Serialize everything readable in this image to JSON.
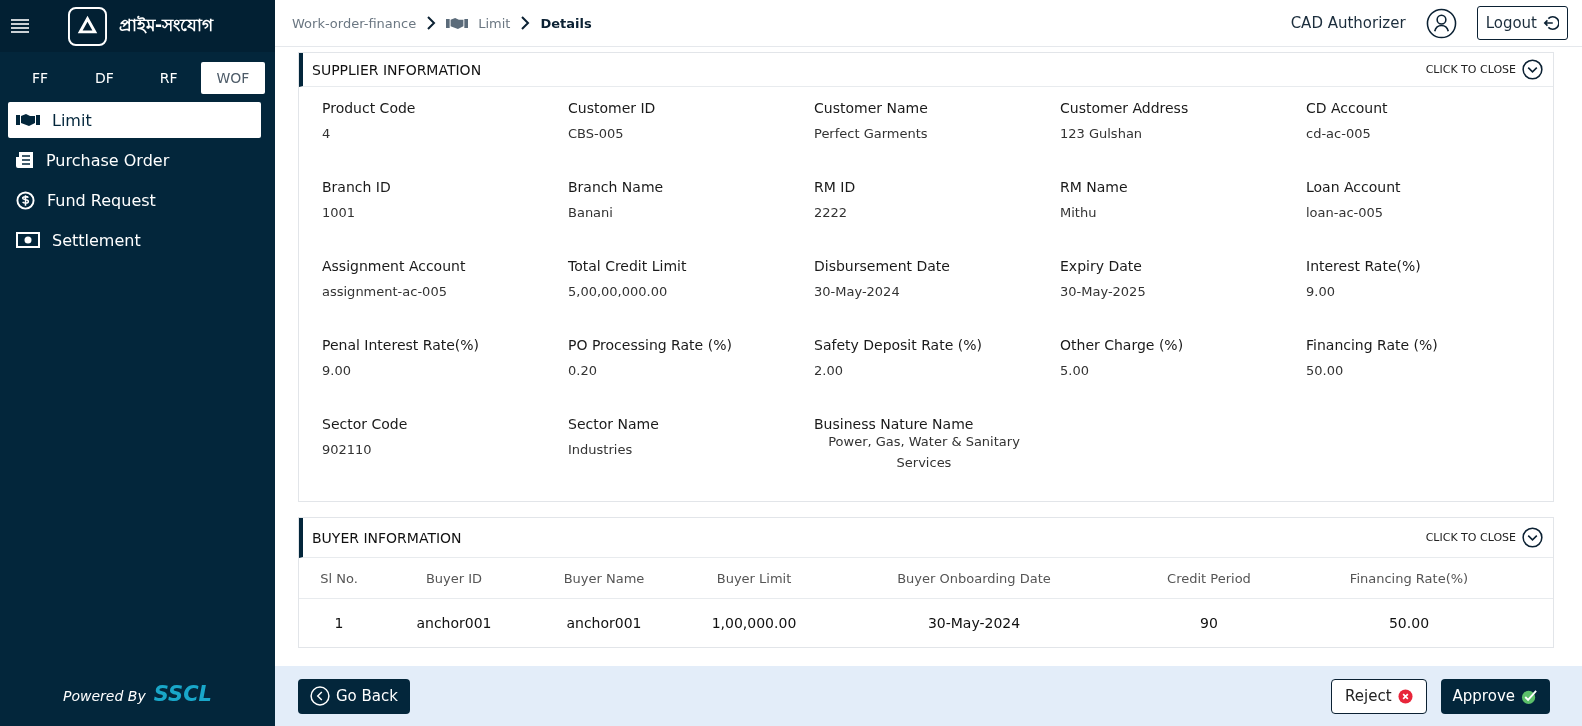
{
  "brand": {
    "name": "প্রাইম-সংযোগ"
  },
  "sector_tabs": [
    {
      "label": "FF",
      "selected": false
    },
    {
      "label": "DF",
      "selected": false
    },
    {
      "label": "RF",
      "selected": false
    },
    {
      "label": "WOF",
      "selected": true
    }
  ],
  "sidebar": {
    "items": [
      {
        "label": "Limit",
        "kind": "handshake",
        "selected": true
      },
      {
        "label": "Purchase Order",
        "kind": "document",
        "selected": false
      },
      {
        "label": "Fund Request",
        "kind": "coin",
        "selected": false
      },
      {
        "label": "Settlement",
        "kind": "banknote",
        "selected": false
      }
    ],
    "powered_by": "Powered By",
    "powered_brand": "SSCL"
  },
  "breadcrumb": [
    {
      "label": "Work-order-finance",
      "kind": "plain"
    },
    {
      "label": "Limit",
      "kind": "handshake"
    },
    {
      "label": "Details",
      "kind": "current"
    }
  ],
  "user": {
    "role": "CAD Authorizer",
    "logout": "Logout"
  },
  "supplier": {
    "title": "SUPPLIER INFORMATION",
    "toggle": "CLICK TO CLOSE",
    "fields": [
      {
        "label": "Product Code",
        "value": "4"
      },
      {
        "label": "Customer ID",
        "value": "CBS-005"
      },
      {
        "label": "Customer Name",
        "value": "Perfect Garments"
      },
      {
        "label": "Customer Address",
        "value": "123 Gulshan"
      },
      {
        "label": "CD Account",
        "value": "cd-ac-005"
      },
      {
        "label": "Branch ID",
        "value": "1001"
      },
      {
        "label": "Branch Name",
        "value": "Banani"
      },
      {
        "label": "RM ID",
        "value": "2222"
      },
      {
        "label": "RM Name",
        "value": "Mithu"
      },
      {
        "label": "Loan Account",
        "value": "loan-ac-005"
      },
      {
        "label": "Assignment Account",
        "value": "assignment-ac-005"
      },
      {
        "label": "Total Credit Limit",
        "value": "5,00,00,000.00"
      },
      {
        "label": "Disbursement Date",
        "value": "30-May-2024"
      },
      {
        "label": "Expiry Date",
        "value": "30-May-2025"
      },
      {
        "label": "Interest Rate(%)",
        "value": "9.00"
      },
      {
        "label": "Penal Interest Rate(%)",
        "value": "9.00"
      },
      {
        "label": "PO Processing Rate (%)",
        "value": "0.20"
      },
      {
        "label": "Safety Deposit Rate (%)",
        "value": "2.00"
      },
      {
        "label": "Other Charge (%)",
        "value": "5.00"
      },
      {
        "label": "Financing Rate (%)",
        "value": "50.00"
      },
      {
        "label": "Sector Code",
        "value": "902110"
      },
      {
        "label": "Sector Name",
        "value": "Industries"
      },
      {
        "label": "Business Nature Name",
        "value": "Power, Gas, Water & Sanitary Services",
        "kind": "centered"
      }
    ]
  },
  "buyer": {
    "title": "BUYER INFORMATION",
    "toggle": "CLICK TO CLOSE",
    "columns": [
      "Sl No.",
      "Buyer ID",
      "Buyer Name",
      "Buyer Limit",
      "Buyer Onboarding Date",
      "Credit Period",
      "Financing Rate(%)"
    ],
    "rows": [
      [
        "1",
        "anchor001",
        "anchor001",
        "1,00,000.00",
        "30-May-2024",
        "90",
        "50.00"
      ]
    ]
  },
  "footer": {
    "back": "Go Back",
    "reject": "Reject",
    "approve": "Approve"
  }
}
